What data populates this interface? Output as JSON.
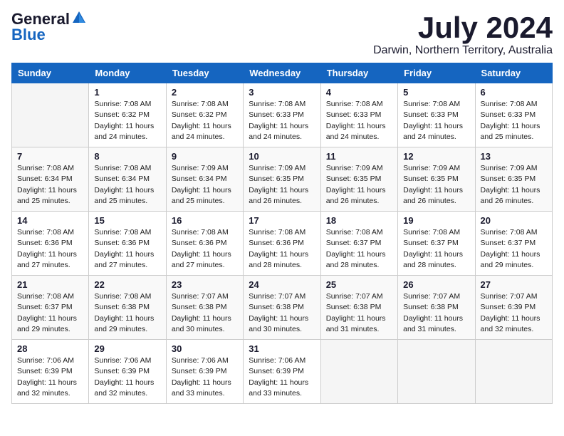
{
  "header": {
    "logo_general": "General",
    "logo_blue": "Blue",
    "month_year": "July 2024",
    "location": "Darwin, Northern Territory, Australia"
  },
  "days_of_week": [
    "Sunday",
    "Monday",
    "Tuesday",
    "Wednesday",
    "Thursday",
    "Friday",
    "Saturday"
  ],
  "weeks": [
    [
      {
        "num": "",
        "sunrise": "",
        "sunset": "",
        "daylight": ""
      },
      {
        "num": "1",
        "sunrise": "Sunrise: 7:08 AM",
        "sunset": "Sunset: 6:32 PM",
        "daylight": "Daylight: 11 hours and 24 minutes."
      },
      {
        "num": "2",
        "sunrise": "Sunrise: 7:08 AM",
        "sunset": "Sunset: 6:32 PM",
        "daylight": "Daylight: 11 hours and 24 minutes."
      },
      {
        "num": "3",
        "sunrise": "Sunrise: 7:08 AM",
        "sunset": "Sunset: 6:33 PM",
        "daylight": "Daylight: 11 hours and 24 minutes."
      },
      {
        "num": "4",
        "sunrise": "Sunrise: 7:08 AM",
        "sunset": "Sunset: 6:33 PM",
        "daylight": "Daylight: 11 hours and 24 minutes."
      },
      {
        "num": "5",
        "sunrise": "Sunrise: 7:08 AM",
        "sunset": "Sunset: 6:33 PM",
        "daylight": "Daylight: 11 hours and 24 minutes."
      },
      {
        "num": "6",
        "sunrise": "Sunrise: 7:08 AM",
        "sunset": "Sunset: 6:33 PM",
        "daylight": "Daylight: 11 hours and 25 minutes."
      }
    ],
    [
      {
        "num": "7",
        "sunrise": "Sunrise: 7:08 AM",
        "sunset": "Sunset: 6:34 PM",
        "daylight": "Daylight: 11 hours and 25 minutes."
      },
      {
        "num": "8",
        "sunrise": "Sunrise: 7:08 AM",
        "sunset": "Sunset: 6:34 PM",
        "daylight": "Daylight: 11 hours and 25 minutes."
      },
      {
        "num": "9",
        "sunrise": "Sunrise: 7:09 AM",
        "sunset": "Sunset: 6:34 PM",
        "daylight": "Daylight: 11 hours and 25 minutes."
      },
      {
        "num": "10",
        "sunrise": "Sunrise: 7:09 AM",
        "sunset": "Sunset: 6:35 PM",
        "daylight": "Daylight: 11 hours and 26 minutes."
      },
      {
        "num": "11",
        "sunrise": "Sunrise: 7:09 AM",
        "sunset": "Sunset: 6:35 PM",
        "daylight": "Daylight: 11 hours and 26 minutes."
      },
      {
        "num": "12",
        "sunrise": "Sunrise: 7:09 AM",
        "sunset": "Sunset: 6:35 PM",
        "daylight": "Daylight: 11 hours and 26 minutes."
      },
      {
        "num": "13",
        "sunrise": "Sunrise: 7:09 AM",
        "sunset": "Sunset: 6:35 PM",
        "daylight": "Daylight: 11 hours and 26 minutes."
      }
    ],
    [
      {
        "num": "14",
        "sunrise": "Sunrise: 7:08 AM",
        "sunset": "Sunset: 6:36 PM",
        "daylight": "Daylight: 11 hours and 27 minutes."
      },
      {
        "num": "15",
        "sunrise": "Sunrise: 7:08 AM",
        "sunset": "Sunset: 6:36 PM",
        "daylight": "Daylight: 11 hours and 27 minutes."
      },
      {
        "num": "16",
        "sunrise": "Sunrise: 7:08 AM",
        "sunset": "Sunset: 6:36 PM",
        "daylight": "Daylight: 11 hours and 27 minutes."
      },
      {
        "num": "17",
        "sunrise": "Sunrise: 7:08 AM",
        "sunset": "Sunset: 6:36 PM",
        "daylight": "Daylight: 11 hours and 28 minutes."
      },
      {
        "num": "18",
        "sunrise": "Sunrise: 7:08 AM",
        "sunset": "Sunset: 6:37 PM",
        "daylight": "Daylight: 11 hours and 28 minutes."
      },
      {
        "num": "19",
        "sunrise": "Sunrise: 7:08 AM",
        "sunset": "Sunset: 6:37 PM",
        "daylight": "Daylight: 11 hours and 28 minutes."
      },
      {
        "num": "20",
        "sunrise": "Sunrise: 7:08 AM",
        "sunset": "Sunset: 6:37 PM",
        "daylight": "Daylight: 11 hours and 29 minutes."
      }
    ],
    [
      {
        "num": "21",
        "sunrise": "Sunrise: 7:08 AM",
        "sunset": "Sunset: 6:37 PM",
        "daylight": "Daylight: 11 hours and 29 minutes."
      },
      {
        "num": "22",
        "sunrise": "Sunrise: 7:08 AM",
        "sunset": "Sunset: 6:38 PM",
        "daylight": "Daylight: 11 hours and 29 minutes."
      },
      {
        "num": "23",
        "sunrise": "Sunrise: 7:07 AM",
        "sunset": "Sunset: 6:38 PM",
        "daylight": "Daylight: 11 hours and 30 minutes."
      },
      {
        "num": "24",
        "sunrise": "Sunrise: 7:07 AM",
        "sunset": "Sunset: 6:38 PM",
        "daylight": "Daylight: 11 hours and 30 minutes."
      },
      {
        "num": "25",
        "sunrise": "Sunrise: 7:07 AM",
        "sunset": "Sunset: 6:38 PM",
        "daylight": "Daylight: 11 hours and 31 minutes."
      },
      {
        "num": "26",
        "sunrise": "Sunrise: 7:07 AM",
        "sunset": "Sunset: 6:38 PM",
        "daylight": "Daylight: 11 hours and 31 minutes."
      },
      {
        "num": "27",
        "sunrise": "Sunrise: 7:07 AM",
        "sunset": "Sunset: 6:39 PM",
        "daylight": "Daylight: 11 hours and 32 minutes."
      }
    ],
    [
      {
        "num": "28",
        "sunrise": "Sunrise: 7:06 AM",
        "sunset": "Sunset: 6:39 PM",
        "daylight": "Daylight: 11 hours and 32 minutes."
      },
      {
        "num": "29",
        "sunrise": "Sunrise: 7:06 AM",
        "sunset": "Sunset: 6:39 PM",
        "daylight": "Daylight: 11 hours and 32 minutes."
      },
      {
        "num": "30",
        "sunrise": "Sunrise: 7:06 AM",
        "sunset": "Sunset: 6:39 PM",
        "daylight": "Daylight: 11 hours and 33 minutes."
      },
      {
        "num": "31",
        "sunrise": "Sunrise: 7:06 AM",
        "sunset": "Sunset: 6:39 PM",
        "daylight": "Daylight: 11 hours and 33 minutes."
      },
      {
        "num": "",
        "sunrise": "",
        "sunset": "",
        "daylight": ""
      },
      {
        "num": "",
        "sunrise": "",
        "sunset": "",
        "daylight": ""
      },
      {
        "num": "",
        "sunrise": "",
        "sunset": "",
        "daylight": ""
      }
    ]
  ]
}
